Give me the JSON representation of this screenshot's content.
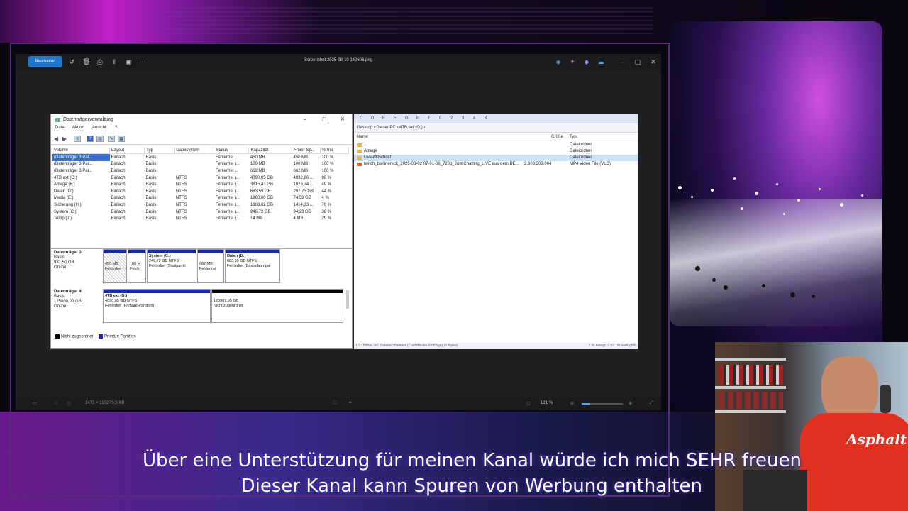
{
  "viewer": {
    "edit_label": "Bearbeiten",
    "file_name": "Screenshot 2025-08-10 142606.png",
    "status_dims": "1472 × 1102",
    "status_size": "79,5 KB",
    "zoom": "121 %"
  },
  "disk_mgmt": {
    "title": "Datenträgerverwaltung",
    "menu": [
      "Datei",
      "Aktion",
      "Ansicht",
      "?"
    ],
    "columns": [
      "Volume",
      "Layout",
      "Typ",
      "Dateisystem",
      "Status",
      "Kapazität",
      "Freier Sp...",
      "% frei"
    ],
    "rows": [
      [
        "(Datenträger 3 Par...",
        "Einfach",
        "Basis",
        "",
        "Fehlerfrei ...",
        "450 MB",
        "450 MB",
        "100 %"
      ],
      [
        "(Datenträger 3 Par...",
        "Einfach",
        "Basis",
        "",
        "Fehlerfrei (...",
        "100 MB",
        "100 MB",
        "100 %"
      ],
      [
        "(Datenträger 3 Par...",
        "Einfach",
        "Basis",
        "",
        "Fehlerfrei ...",
        "662 MB",
        "662 MB",
        "100 %"
      ],
      [
        "4TB ext (G:)",
        "Einfach",
        "Basis",
        "NTFS",
        "Fehlerfrei (...",
        "4090,05 GB",
        "4032,86 ...",
        "98 %"
      ],
      [
        "Ablage (F:)",
        "Einfach",
        "Basis",
        "NTFS",
        "Fehlerfrei (...",
        "3815,43 GB",
        "1873,74 ...",
        "49 %"
      ],
      [
        "Daten (D:)",
        "Einfach",
        "Basis",
        "NTFS",
        "Fehlerfrei (...",
        "683,59 GB",
        "297,73 GB",
        "44 %"
      ],
      [
        "Media (E:)",
        "Einfach",
        "Basis",
        "NTFS",
        "Fehlerfrei (...",
        "1860,00 GB",
        "74,53 GB",
        "4 %"
      ],
      [
        "Sicherung (H:)",
        "Einfach",
        "Basis",
        "NTFS",
        "Fehlerfrei (...",
        "1863,02 GB",
        "1414,33 ...",
        "76 %"
      ],
      [
        "System (C:)",
        "Einfach",
        "Basis",
        "NTFS",
        "Fehlerfrei (...",
        "246,72 GB",
        "94,23 GB",
        "38 %"
      ],
      [
        "Temp (T:)",
        "Einfach",
        "Basis",
        "NTFS",
        "Fehlerfrei (...",
        "14 MB",
        "4 MB",
        "29 %"
      ]
    ],
    "disk3": {
      "name": "Datenträger 3",
      "type": "Basis",
      "size": "931,50 GB",
      "state": "Online",
      "p1_size": "450 MB",
      "p1_status": "Fehlerfrei",
      "p2_size": "100 M",
      "p2_status": "Fehler",
      "p3_name": "System (C:)",
      "p3_size": "246,72 GB NTFS",
      "p3_status": "Fehlerfrei (Startpartiti",
      "p4_size": "662 MB",
      "p4_status": "Fehlerfrei",
      "p5_name": "Daten (D:)",
      "p5_size": "683,59 GB NTFS",
      "p5_status": "Fehlerfrei (Basisdatenpa"
    },
    "disk4": {
      "name": "Datenträger 4",
      "type": "Basis",
      "size": "125000,00 GB",
      "state": "Online",
      "p1_name": "4TB ext (G:)",
      "p1_size": "4090,05 GB NTFS",
      "p1_status": "Fehlerfrei (Primäre Partition)",
      "p2_size": "120901,95 GB",
      "p2_status": "Nicht zugeordnet"
    },
    "legend_unalloc": "Nicht zugeordnet",
    "legend_primary": "Primäre Partition"
  },
  "explorer": {
    "toolbar_drives": [
      "C",
      "D",
      "E",
      "F",
      "G",
      "H",
      "T",
      "0",
      "2",
      "3",
      "4",
      "8"
    ],
    "address": "Desktop › Dieser PC › 4TB ext (G:) ›",
    "col_name": "Name",
    "col_size": "Größe",
    "col_type": "Typ",
    "items": [
      {
        "name": "..",
        "size": "",
        "type": "Dateiordner"
      },
      {
        "name": "Ablage",
        "size": "",
        "type": "Dateiordner"
      },
      {
        "name": "Live-Mitschnitt",
        "size": "",
        "type": "Dateiordner"
      },
      {
        "name": "twitch_berlinereck_2025-08-02 07-01-06_720p_Just Chatting_LIVE aus dem BE...",
        "size": "2.603.203.004",
        "type": "MP4 Video File (VLC)"
      }
    ],
    "status_left": "1/2 Ordner, 0/1 Dateien markiert (7 versteckte Einträge) (0 Bytes)",
    "status_right": "7 % belegt, 3,93 TiB verfügbar"
  },
  "overlay": {
    "shirt_text": "Asphalt",
    "subtitle_1": "Über eine Unterstützung für meinen Kanal würde ich mich SEHR freuen",
    "subtitle_2": "Dieser Kanal kann Spuren von Werbung enthalten"
  },
  "colors": {
    "accent": "#1e78d0",
    "partition_bar": "#1c2aa0",
    "subtitle_glow": "#6040ff"
  }
}
